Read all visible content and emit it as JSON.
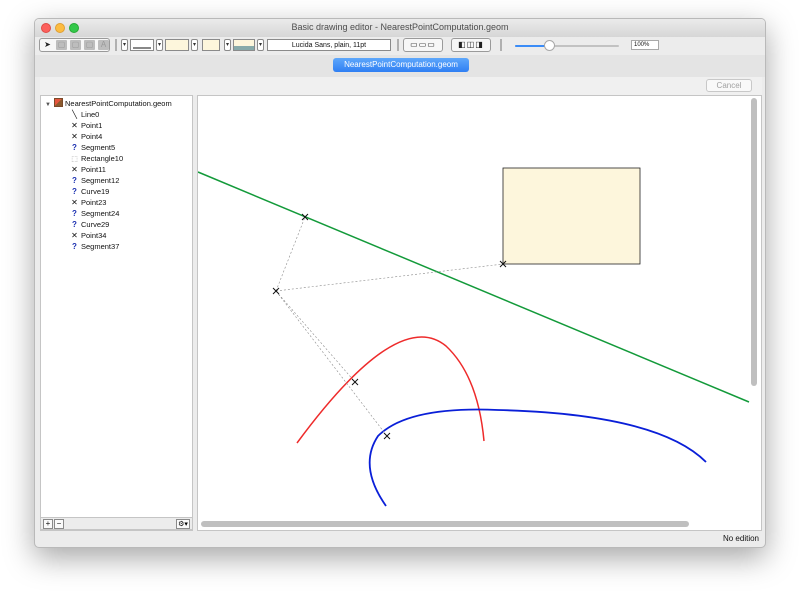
{
  "window": {
    "title": "Basic drawing editor - NearestPointComputation.geom"
  },
  "toolbar": {
    "font_label": "Lucida Sans, plain, 11pt",
    "zoom_label": "100%",
    "zoom_value": 0.33
  },
  "tab": {
    "label": "NearestPointComputation.geom"
  },
  "cancel_label": "Cancel",
  "tree": {
    "root": "NearestPointComputation.geom",
    "items": [
      {
        "label": "Line0",
        "icon": "line-icon"
      },
      {
        "label": "Point1",
        "icon": "point-icon"
      },
      {
        "label": "Point4",
        "icon": "point-icon"
      },
      {
        "label": "Segment5",
        "icon": "question-icon"
      },
      {
        "label": "Rectangle10",
        "icon": "rectangle-icon"
      },
      {
        "label": "Point11",
        "icon": "point-icon"
      },
      {
        "label": "Segment12",
        "icon": "question-icon"
      },
      {
        "label": "Curve19",
        "icon": "question-icon"
      },
      {
        "label": "Point23",
        "icon": "point-icon"
      },
      {
        "label": "Segment24",
        "icon": "question-icon"
      },
      {
        "label": "Curve29",
        "icon": "question-icon"
      },
      {
        "label": "Point34",
        "icon": "point-icon"
      },
      {
        "label": "Segment37",
        "icon": "question-icon"
      }
    ]
  },
  "status": {
    "text": "No edition"
  },
  "colors": {
    "line": "#139a3a",
    "red_curve": "#ee2b2b",
    "blue_curve": "#0a1fd8",
    "rect_fill": "#fdf6dc",
    "dashed": "#8a8a8a",
    "tab_accent": "#2f7ff3"
  }
}
